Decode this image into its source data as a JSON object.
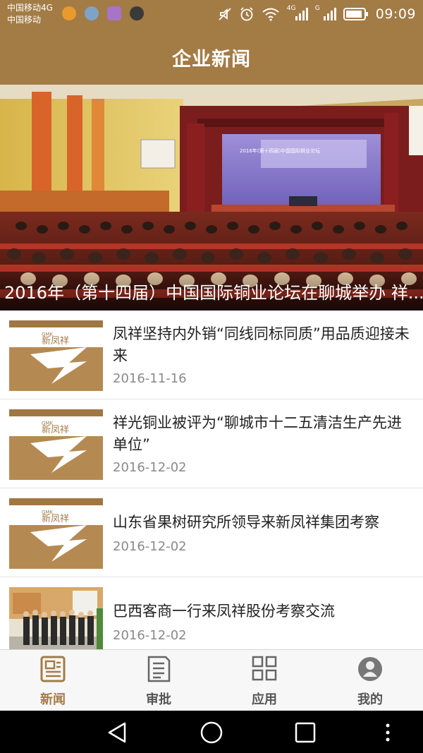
{
  "status_bar": {
    "carrier_line1": "中国移动4G",
    "carrier_line2": "中国移动",
    "net_4g": "4G",
    "net_g": "G",
    "time": "09:09"
  },
  "header": {
    "title": "企业新闻"
  },
  "banner": {
    "caption": "2016年（第十四届）中国国际铜业论坛在聊城举办 祥...",
    "screen_text": "2016年(第十四届)中国国际铜业论坛"
  },
  "logo_text": {
    "gmk": "GMK",
    "brand": "新凤祥"
  },
  "news": [
    {
      "title": "凤祥坚持内外销“同线同标同质”用品质迎接未来",
      "date": "2016-11-16"
    },
    {
      "title": "祥光铜业被评为“聊城市十二五清洁生产先进单位”",
      "date": "2016-12-02"
    },
    {
      "title": "山东省果树研究所领导来新凤祥集团考察",
      "date": "2016-12-02"
    },
    {
      "title": "巴西客商一行来凤祥股份考察交流",
      "date": "2016-12-02"
    }
  ],
  "tabs": [
    {
      "label": "新闻",
      "icon": "newspaper-icon",
      "active": true
    },
    {
      "label": "审批",
      "icon": "document-icon",
      "active": false
    },
    {
      "label": "应用",
      "icon": "grid-icon",
      "active": false
    },
    {
      "label": "我的",
      "icon": "person-icon",
      "active": false
    }
  ],
  "colors": {
    "brand": "#a37b45",
    "active_tab": "#a37b45",
    "inactive_tab": "#555555"
  }
}
